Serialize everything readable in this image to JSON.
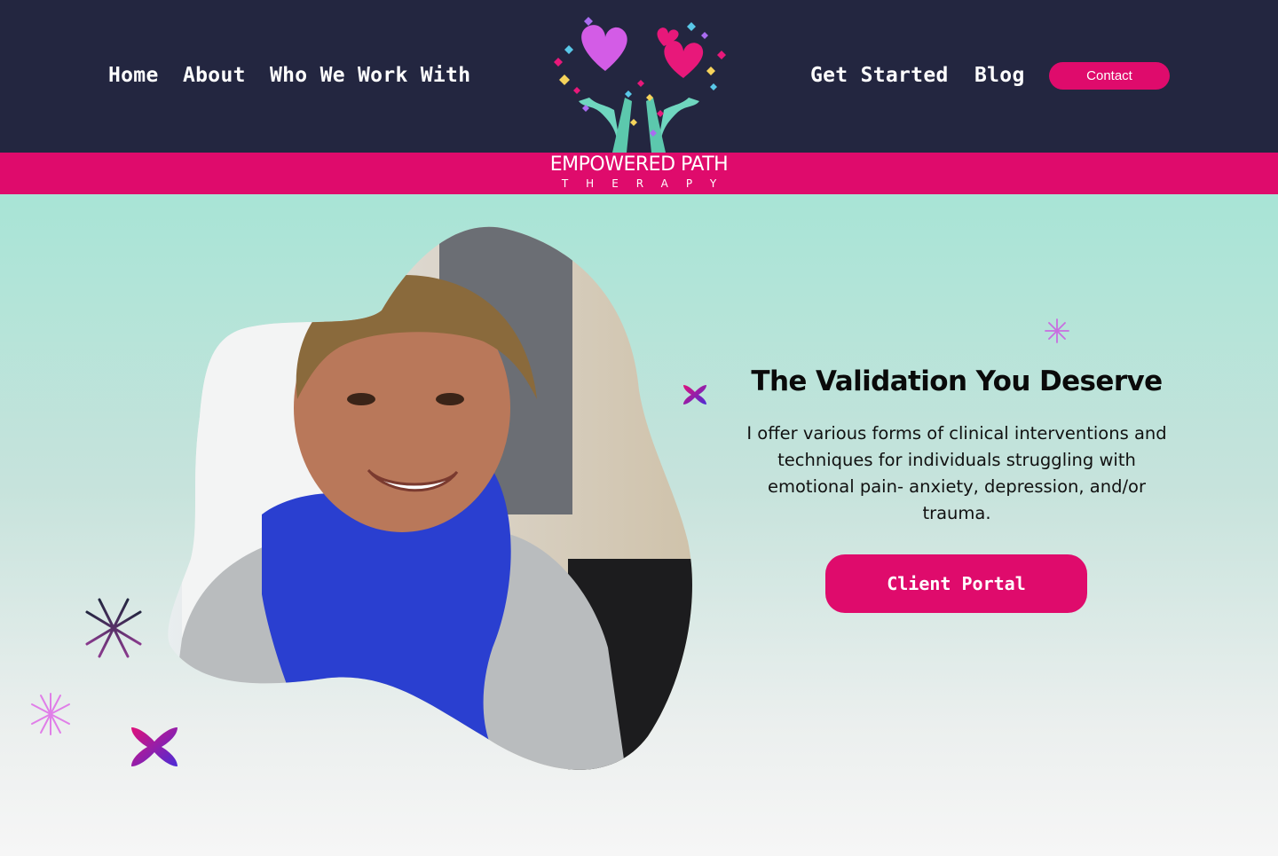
{
  "nav": {
    "left": [
      "Home",
      "About",
      "Who We Work With"
    ],
    "right": [
      "Get Started",
      "Blog"
    ],
    "contact": "Contact"
  },
  "logo": {
    "name": "EMPOWERED PATH",
    "sub": "THERAPY",
    "icon": "hands-hearts-tree-logo"
  },
  "hero": {
    "title": "The Validation You Deserve",
    "text": "I offer various forms of clinical interventions and techniques for individuals struggling with emotional pain- anxiety, depression, and/or trauma.",
    "button": "Client Portal",
    "photo": "smiling-woman-portrait"
  },
  "colors": {
    "navy": "#232640",
    "pink": "#df0b6c",
    "mint": "#a8e4d6",
    "purple": "#5b2bd0",
    "lilac": "#d57be8"
  }
}
